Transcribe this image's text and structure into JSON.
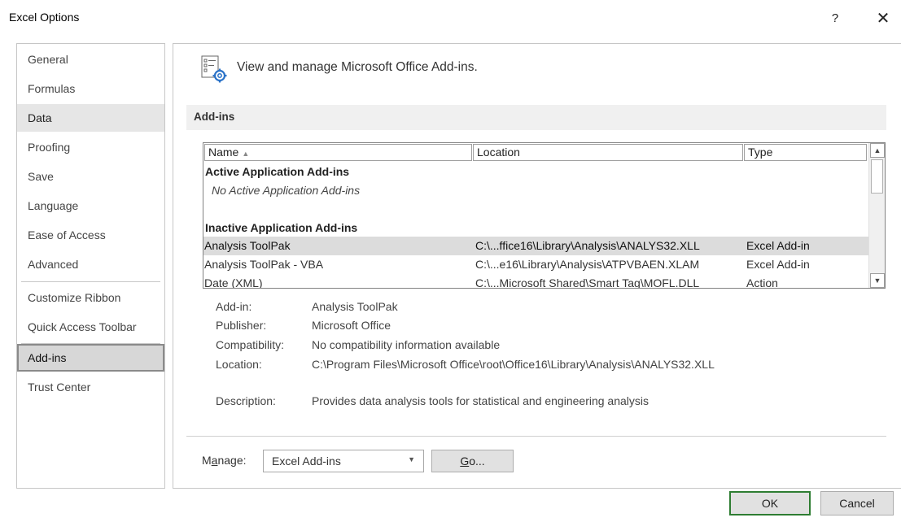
{
  "window": {
    "title": "Excel Options",
    "help": "?",
    "close": "✕"
  },
  "nav": {
    "items": [
      {
        "label": "General"
      },
      {
        "label": "Formulas"
      },
      {
        "label": "Data"
      },
      {
        "label": "Proofing"
      },
      {
        "label": "Save"
      },
      {
        "label": "Language"
      },
      {
        "label": "Ease of Access"
      },
      {
        "label": "Advanced"
      },
      {
        "label": "Customize Ribbon"
      },
      {
        "label": "Quick Access Toolbar"
      },
      {
        "label": "Add-ins"
      },
      {
        "label": "Trust Center"
      }
    ],
    "selected": "Add-ins"
  },
  "header": {
    "title": "View and manage Microsoft Office Add-ins."
  },
  "section": {
    "title": "Add-ins"
  },
  "list": {
    "columns": {
      "name": "Name",
      "location": "Location",
      "type": "Type",
      "sort_arrow": "▲"
    },
    "groups": [
      {
        "title": "Active Application Add-ins",
        "empty_text": "No Active Application Add-ins"
      },
      {
        "title": "Inactive Application Add-ins"
      }
    ],
    "rows": [
      {
        "name": "Analysis ToolPak",
        "location": "C:\\...ffice16\\Library\\Analysis\\ANALYS32.XLL",
        "type": "Excel Add-in"
      },
      {
        "name": "Analysis ToolPak - VBA",
        "location": "C:\\...e16\\Library\\Analysis\\ATPVBAEN.XLAM",
        "type": "Excel Add-in"
      },
      {
        "name": "Date (XML)",
        "location": "C:\\...Microsoft Shared\\Smart Tag\\MOFL.DLL",
        "type": "Action"
      }
    ],
    "selected_row": 0,
    "scroll_up": "▲",
    "scroll_down": "▼"
  },
  "details": {
    "addin_label": "Add-in:",
    "addin_value": "Analysis ToolPak",
    "publisher_label": "Publisher:",
    "publisher_value": "Microsoft Office",
    "compat_label": "Compatibility:",
    "compat_value": "No compatibility information available",
    "location_label": "Location:",
    "location_value": "C:\\Program Files\\Microsoft Office\\root\\Office16\\Library\\Analysis\\ANALYS32.XLL",
    "description_label": "Description:",
    "description_value": "Provides data analysis tools for statistical and engineering analysis"
  },
  "manage": {
    "label_pre": "M",
    "label_key": "a",
    "label_post": "nage:",
    "selected": "Excel Add-ins",
    "arrow": "▼",
    "go_key": "G",
    "go_post": "o..."
  },
  "buttons": {
    "ok": "OK",
    "cancel": "Cancel"
  },
  "colors": {
    "ok_border": "#2e7d32",
    "selected_row": "#dcdcdc",
    "section_bg": "#f0f0f0"
  }
}
